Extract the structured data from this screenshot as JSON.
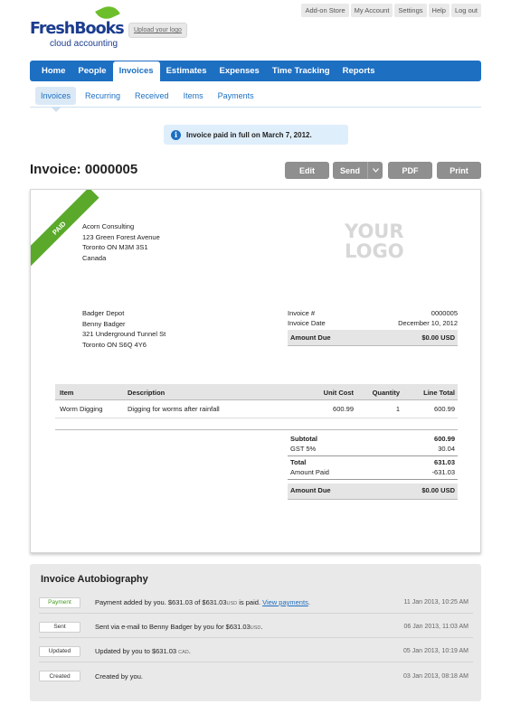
{
  "topnav": [
    "Add-on Store",
    "My Account",
    "Settings",
    "Help",
    "Log out"
  ],
  "brand": {
    "name": "FreshBooks",
    "tagline": "cloud accounting",
    "upload_label": "Upload your logo"
  },
  "mainnav": [
    "Home",
    "People",
    "Invoices",
    "Estimates",
    "Expenses",
    "Time Tracking",
    "Reports"
  ],
  "subnav": [
    "Invoices",
    "Recurring",
    "Received",
    "Items",
    "Payments"
  ],
  "notice": "Invoice paid in full on March 7, 2012.",
  "invoice": {
    "title": "Invoice: 0000005",
    "buttons": {
      "edit": "Edit",
      "send": "Send",
      "pdf": "PDF",
      "print": "Print"
    },
    "status_ribbon": "PAID",
    "from": [
      "Acorn Consulting",
      "123 Green Forest Avenue",
      "Toronto ON  M3M 3S1",
      "Canada"
    ],
    "logo_placeholder": [
      "YOUR",
      "LOGO"
    ],
    "to": [
      "Badger Depot",
      "Benny Badger",
      "321 Underground Tunnel St",
      "Toronto ON  S6Q 4Y6"
    ],
    "meta": {
      "number_label": "Invoice #",
      "number": "0000005",
      "date_label": "Invoice Date",
      "date": "December 10, 2012",
      "due_label": "Amount Due",
      "due": "$0.00 USD"
    },
    "table": {
      "headers": [
        "Item",
        "Description",
        "Unit Cost",
        "Quantity",
        "Line Total"
      ],
      "rows": [
        [
          "Worm Digging",
          "Digging for worms after rainfall",
          "600.99",
          "1",
          "600.99"
        ]
      ]
    },
    "totals": {
      "subtotal_label": "Subtotal",
      "subtotal": "600.99",
      "tax_label": "GST 5%",
      "tax": "30.04",
      "total_label": "Total",
      "total": "631.03",
      "paid_label": "Amount Paid",
      "paid": "-631.03",
      "due_label": "Amount Due",
      "due": "$0.00 USD"
    }
  },
  "autobiography": {
    "title": "Invoice Autobiography",
    "entries": [
      {
        "tag": "Payment",
        "pre": "Payment added by you. $631.03 of $631.03",
        "unit": "USD",
        "post": " is paid. ",
        "link": "View payments",
        "tail": ".",
        "date": "11 Jan 2013, 10:25 AM"
      },
      {
        "tag": "Sent",
        "pre": "Sent via e-mail to Benny Badger by you for $631.03",
        "unit": "USD",
        "post": ".",
        "link": "",
        "tail": "",
        "date": "06 Jan 2013, 11:03 AM"
      },
      {
        "tag": "Updated",
        "pre": "Updated by you to $631.03",
        "unit": "CAD",
        "post": ".",
        "link": "",
        "tail": "",
        "date": "05 Jan 2013, 10:19 AM"
      },
      {
        "tag": "Created",
        "pre": "Created by you.",
        "unit": "",
        "post": "",
        "link": "",
        "tail": "",
        "date": "03 Jan 2013, 08:18 AM"
      }
    ]
  },
  "colors": {
    "brand_blue": "#1d6fc2",
    "paid_green": "#5aa92a",
    "button_gray": "#8f8f8f"
  }
}
